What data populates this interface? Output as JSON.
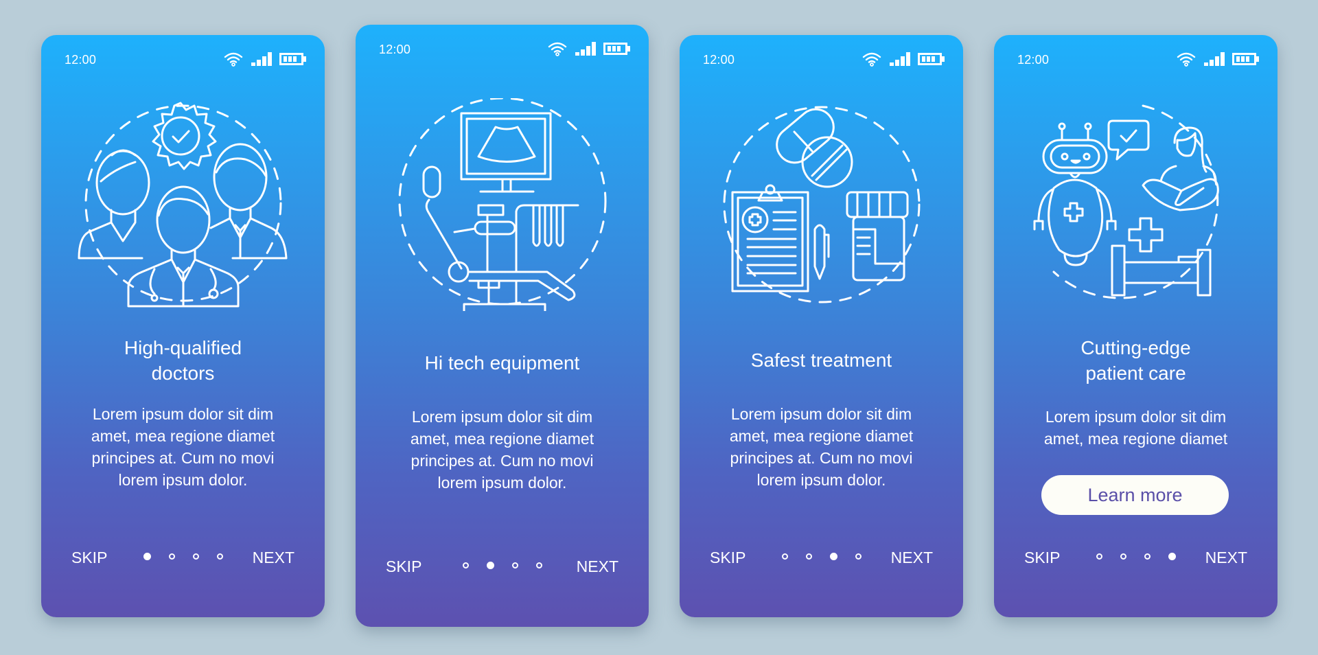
{
  "background_color": "#b9cdd8",
  "gradient": {
    "top": "#1eb1fc",
    "bottom": "#5d51b0"
  },
  "screens": [
    {
      "time": "12:00",
      "illustration": "doctors-team-icon",
      "title_lines": [
        "High-qualified",
        "doctors"
      ],
      "body_lines": [
        "Lorem ipsum dolor sit dim",
        "amet, mea regione diamet",
        "principes at. Cum no movi",
        "lorem ipsum dolor."
      ],
      "skip_label": "SKIP",
      "next_label": "NEXT",
      "active_page": 1,
      "page_count": 4
    },
    {
      "time": "12:00",
      "illustration": "dental-ultrasound-equipment-icon",
      "title_lines": [
        "Hi tech equipment"
      ],
      "body_lines": [
        "Lorem ipsum dolor sit dim",
        "amet, mea regione diamet",
        "principes at. Cum no movi",
        "lorem ipsum dolor."
      ],
      "skip_label": "SKIP",
      "next_label": "NEXT",
      "active_page": 2,
      "page_count": 4
    },
    {
      "time": "12:00",
      "illustration": "pills-prescription-icon",
      "title_lines": [
        "Safest treatment"
      ],
      "body_lines": [
        "Lorem ipsum dolor sit dim",
        "amet, mea regione diamet",
        "principes at. Cum no movi",
        "lorem ipsum dolor."
      ],
      "skip_label": "SKIP",
      "next_label": "NEXT",
      "active_page": 3,
      "page_count": 4
    },
    {
      "time": "12:00",
      "illustration": "robot-patient-care-icon",
      "title_lines": [
        "Cutting-edge",
        "patient care"
      ],
      "body_lines": [
        "Lorem ipsum dolor sit dim",
        "amet, mea regione diamet"
      ],
      "button_label": "Learn more",
      "button_text_color": "#5a4fa8",
      "skip_label": "SKIP",
      "next_label": "NEXT",
      "active_page": 4,
      "page_count": 4
    }
  ]
}
